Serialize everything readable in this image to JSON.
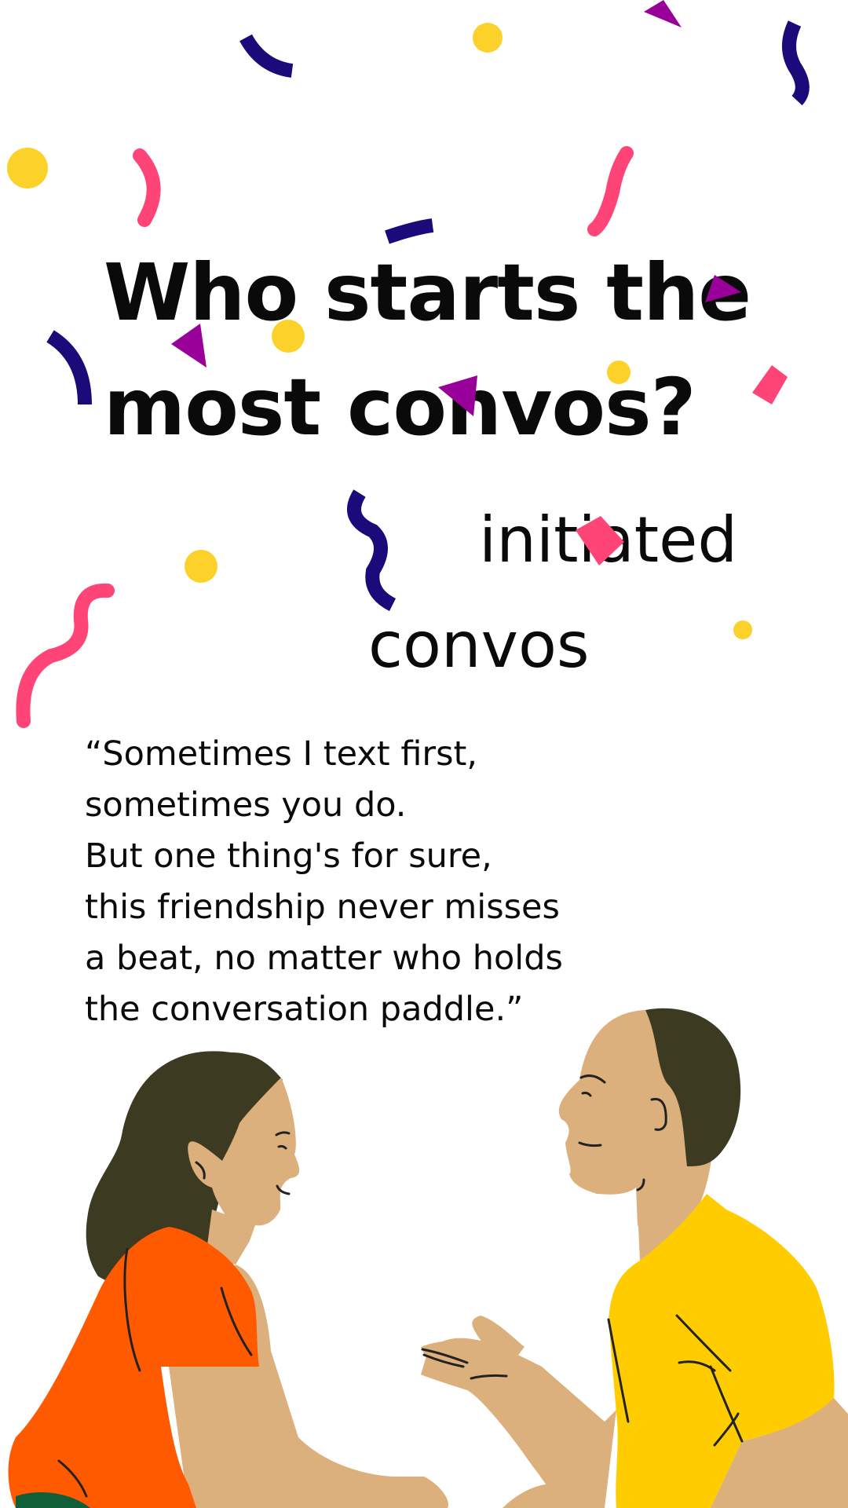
{
  "title": {
    "line1": "Who starts the",
    "line2": "most convos?"
  },
  "stat": {
    "line1": "initiated",
    "line2": "convos"
  },
  "quote": {
    "lines": [
      "“Sometimes I text first,",
      "sometimes you do.",
      "But one thing's for sure,",
      "this friendship never misses",
      "a beat, no matter who holds",
      "the conversation paddle.”"
    ]
  },
  "colors": {
    "background": "#ffffff",
    "text": "#0a0a0a",
    "confetti_yellow": "#fcd12a",
    "confetti_navy": "#1a0a7a",
    "confetti_pink": "#ff4477",
    "confetti_purple": "#990099",
    "woman_shirt": "#ff5a00",
    "man_shirt": "#ffcc00",
    "skin": "#dcb07c",
    "hair": "#3d3a22"
  }
}
